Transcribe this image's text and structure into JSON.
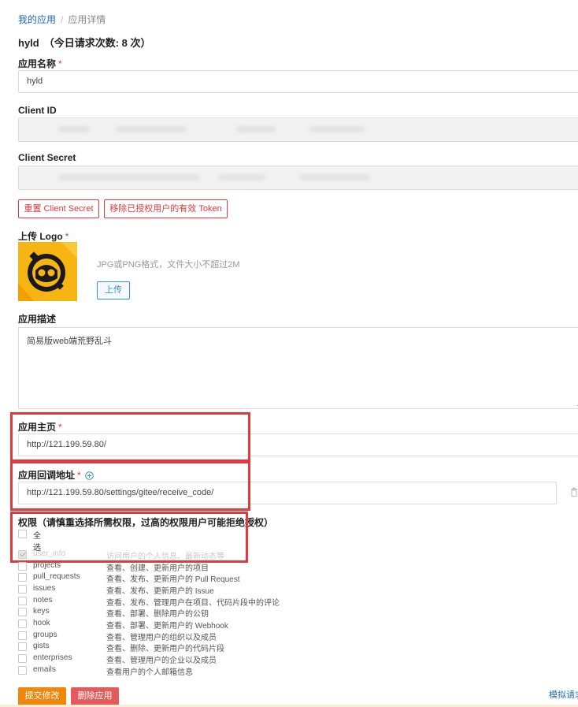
{
  "breadcrumb": {
    "root": "我的应用",
    "separator": "/",
    "current": "应用详情"
  },
  "header": {
    "app_name": "hyld",
    "request_count": "（今日请求次数: 8 次）"
  },
  "fields": {
    "name": {
      "label": "应用名称",
      "required_mark": "*",
      "value": "hyld"
    },
    "client_id": {
      "label": "Client ID"
    },
    "client_secret": {
      "label": "Client Secret"
    },
    "logo": {
      "label": "上传 Logo",
      "required_mark": "*",
      "hint": "JPG或PNG格式，文件大小不超过2M",
      "upload_label": "上传"
    },
    "description": {
      "label": "应用描述",
      "value": "简易版web端荒野乱斗"
    },
    "homepage": {
      "label": "应用主页",
      "required_mark": "*",
      "value": "http://121.199.59.80/"
    },
    "callback": {
      "label": "应用回调地址",
      "required_mark": "*",
      "value": "http://121.199.59.80/settings/gitee/receive_code/"
    }
  },
  "actions": {
    "reset_secret": "重置 Client Secret",
    "revoke_tokens": "移除已授权用户的有效 Token",
    "submit": "提交修改",
    "delete": "删除应用",
    "simulate": "模拟请求"
  },
  "permissions": {
    "title": "权限（请慎重选择所需权限，过高的权限用户可能拒绝授权）",
    "select_all": "全选",
    "items": [
      {
        "name": "user_info",
        "desc": "访问用户的个人信息、最新动态等",
        "checked": true
      },
      {
        "name": "projects",
        "desc": "查看、创建、更新用户的项目",
        "checked": false
      },
      {
        "name": "pull_requests",
        "desc": "查看、发布、更新用户的 Pull Request",
        "checked": false
      },
      {
        "name": "issues",
        "desc": "查看、发布、更新用户的 Issue",
        "checked": false
      },
      {
        "name": "notes",
        "desc": "查看、发布、管理用户在项目、代码片段中的评论",
        "checked": false
      },
      {
        "name": "keys",
        "desc": "查看、部署、删除用户的公钥",
        "checked": false
      },
      {
        "name": "hook",
        "desc": "查看、部署、更新用户的 Webhook",
        "checked": false
      },
      {
        "name": "groups",
        "desc": "查看、管理用户的组织以及成员",
        "checked": false
      },
      {
        "name": "gists",
        "desc": "查看、删除、更新用户的代码片段",
        "checked": false
      },
      {
        "name": "enterprises",
        "desc": "查看、管理用户的企业以及成员",
        "checked": false
      },
      {
        "name": "emails",
        "desc": "查看用户的个人邮箱信息",
        "checked": false
      }
    ]
  },
  "colors": {
    "required": "#e4393c",
    "link": "#1f6bb5",
    "primary_action": "#f0860a",
    "danger_action": "#e35b5b",
    "highlight_box": "#e4393c"
  }
}
